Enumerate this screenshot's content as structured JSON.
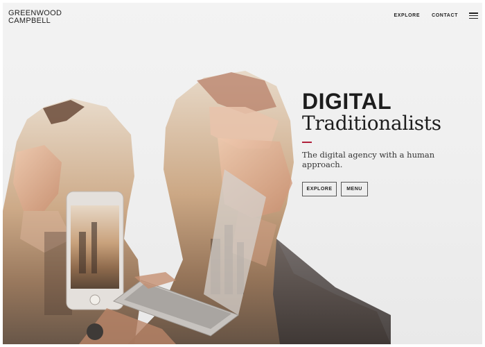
{
  "brand": {
    "line1": "GREENWOOD",
    "line2": "CAMPBELL"
  },
  "nav": {
    "items": [
      "EXPLORE",
      "CONTACT"
    ],
    "menu_icon": "hamburger-menu-icon"
  },
  "hero": {
    "title_line1": "DIGITAL",
    "title_line2": "Traditionalists",
    "tagline": "The digital agency with a human approach.",
    "buttons": {
      "explore": "EXPLORE",
      "menu": "MENU"
    }
  },
  "colors": {
    "accent": "#b0203a",
    "text": "#1d1d1d",
    "background": "#efefef"
  }
}
